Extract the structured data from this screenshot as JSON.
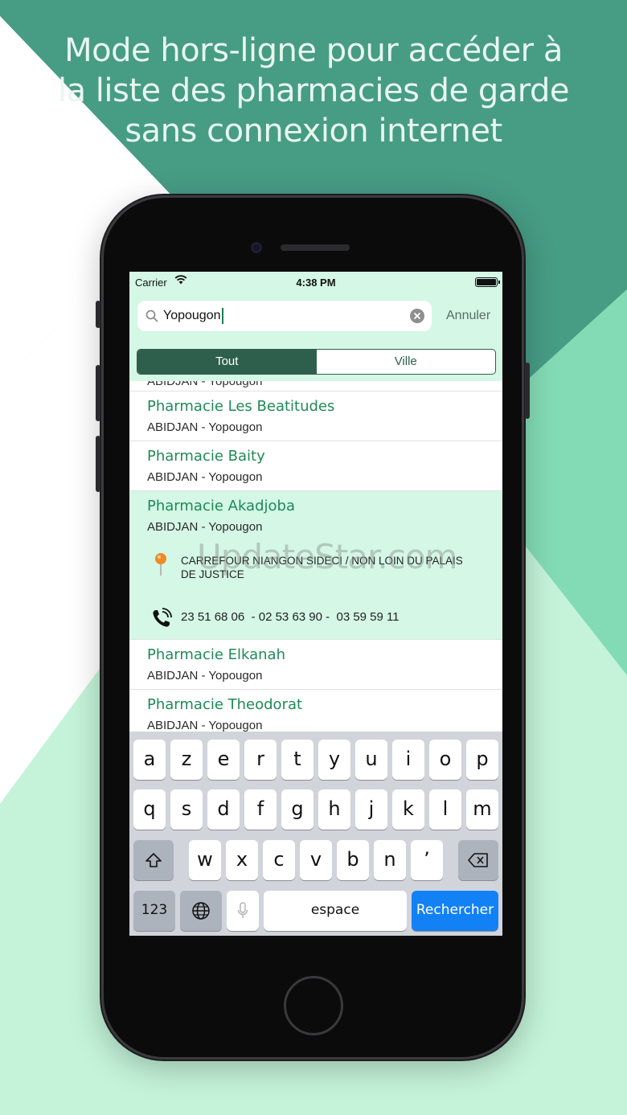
{
  "headline": {
    "line1": "Mode hors-ligne pour accéder à",
    "line2": "la liste des pharmacies de garde",
    "line3": "sans connexion internet"
  },
  "status_bar": {
    "carrier": "Carrier",
    "time": "4:38 PM"
  },
  "search": {
    "value": "Yopougon",
    "cancel_label": "Annuler"
  },
  "segments": {
    "all_label": "Tout",
    "city_label": "Ville",
    "selected": "Tout"
  },
  "list": {
    "partial_location": "ABIDJAN - Yopougon",
    "items": [
      {
        "name": "Pharmacie Les Beatitudes",
        "location": "ABIDJAN - Yopougon"
      },
      {
        "name": "Pharmacie Baity",
        "location": "ABIDJAN - Yopougon"
      },
      {
        "name": "Pharmacie Akadjoba",
        "location": "ABIDJAN - Yopougon",
        "address": "CARREFOUR NIANGON SIDECI / NON LOIN DU PALAIS DE JUSTICE",
        "phones": "23 51 68 06  - 02 53 63 90 -  03 59 59 11"
      },
      {
        "name": "Pharmacie Elkanah",
        "location": "ABIDJAN - Yopougon"
      },
      {
        "name": "Pharmacie Theodorat",
        "location": "ABIDJAN - Yopougon"
      }
    ]
  },
  "watermark": "UpdateStar.com",
  "keyboard": {
    "row1": [
      "a",
      "z",
      "e",
      "r",
      "t",
      "y",
      "u",
      "i",
      "o",
      "p"
    ],
    "row2": [
      "q",
      "s",
      "d",
      "f",
      "g",
      "h",
      "j",
      "k",
      "l",
      "m"
    ],
    "row3": [
      "w",
      "x",
      "c",
      "v",
      "b",
      "n",
      "’"
    ],
    "numbers_label": "123",
    "space_label": "espace",
    "search_label": "Rechercher"
  },
  "colors": {
    "brand_dark": "#4a9e86",
    "brand_light": "#c6f5da",
    "accent_green": "#1f8a56",
    "segment_active": "#2e5f4d",
    "search_key": "#1381f6"
  },
  "icons": [
    "search-icon",
    "clear-icon",
    "wifi-icon",
    "battery-icon",
    "map-pin-icon",
    "phone-icon",
    "shift-icon",
    "backspace-icon",
    "globe-icon",
    "microphone-icon"
  ]
}
